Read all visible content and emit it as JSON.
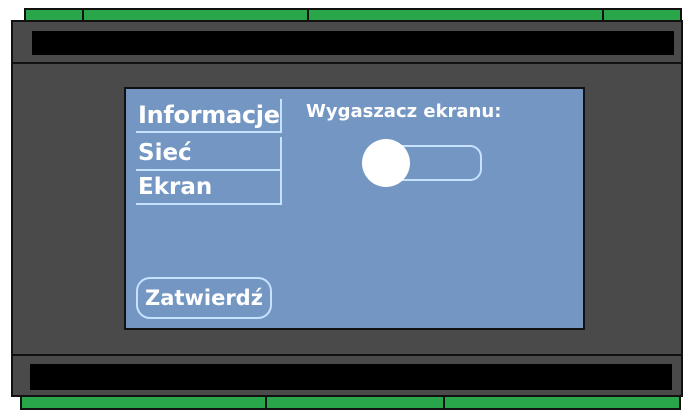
{
  "menu": {
    "items": [
      {
        "label": "Informacje"
      },
      {
        "label": "Sieć"
      },
      {
        "label": "Ekran"
      }
    ]
  },
  "screen_saver": {
    "label": "Wygaszacz ekranu:",
    "toggle_state": "off"
  },
  "confirm_button": {
    "label": "Zatwierdź"
  },
  "colors": {
    "screen_background": "#7496c2",
    "housing": "#4a4a4a",
    "connector": "#2aa64a",
    "outline": "#c7e2ff"
  }
}
